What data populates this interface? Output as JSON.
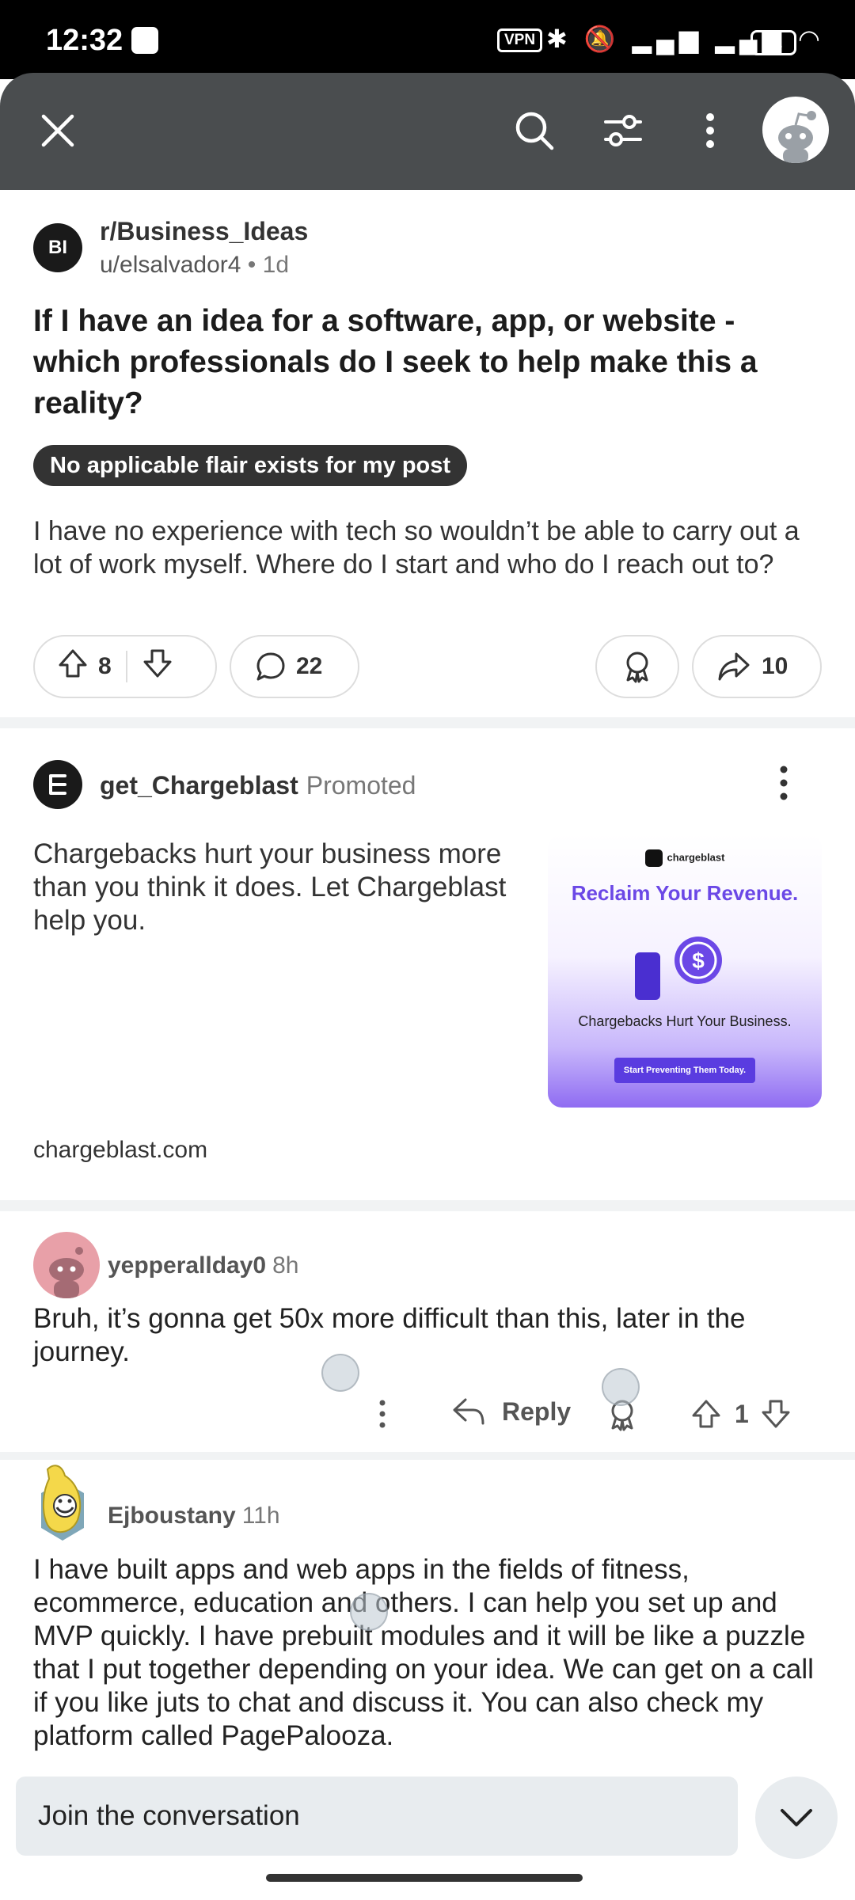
{
  "status_bar": {
    "time": "12:32",
    "vpn": "VPN",
    "battery": "31"
  },
  "post": {
    "subreddit": "r/Business_Ideas",
    "subreddit_icon_text": "BI",
    "author": "u/elsalvador4",
    "separator": "•",
    "age": "1d",
    "title": "If I have an idea for a software, app, or website - which professionals do I seek to help make this a reality?",
    "flair": "No applicable flair exists for my post",
    "body": "I have no experience with tech so wouldn’t be able to carry out a lot of work myself. Where do I start and who do I reach out to?",
    "votes": "8",
    "comments": "22",
    "shares": "10"
  },
  "ad": {
    "name": "get_Chargeblast",
    "promoted": "Promoted",
    "text": "Chargebacks hurt your business more than you think it does. Let Chargeblast help you.",
    "image": {
      "brand": "chargeblast",
      "headline": "Reclaim Your Revenue.",
      "sub": "Chargebacks Hurt Your Business.",
      "cta": "Start Preventing Them Today."
    },
    "domain": "chargeblast.com"
  },
  "comments": [
    {
      "user": "yepperallday0",
      "age": "8h",
      "text": "Bruh, it’s gonna get 50x more difficult than this, later in the journey.",
      "reply_label": "Reply",
      "votes": "1"
    },
    {
      "user": "Ejboustany",
      "age": "11h",
      "text": "I have built apps and web apps in the fields of fitness, ecommerce, education and others. I can help you set up and MVP quickly. I have prebuilt modules and it will be like a puzzle that I put together depending on your idea. We can get on a call if you like juts to chat and discuss it. You can also check my platform called PagePalooza."
    }
  ],
  "composer": {
    "placeholder": "Join the conversation"
  },
  "colors": {
    "appbar": "#4a4d4f",
    "flair_bg": "#333333",
    "divider": "#f1f3f4",
    "ad_accent": "#6b48e6"
  },
  "icons": [
    "close-icon",
    "search-icon",
    "filter-icon",
    "more-vert-icon",
    "upvote-icon",
    "downvote-icon",
    "comment-icon",
    "award-icon",
    "share-icon",
    "reply-icon",
    "chevron-down-icon"
  ]
}
